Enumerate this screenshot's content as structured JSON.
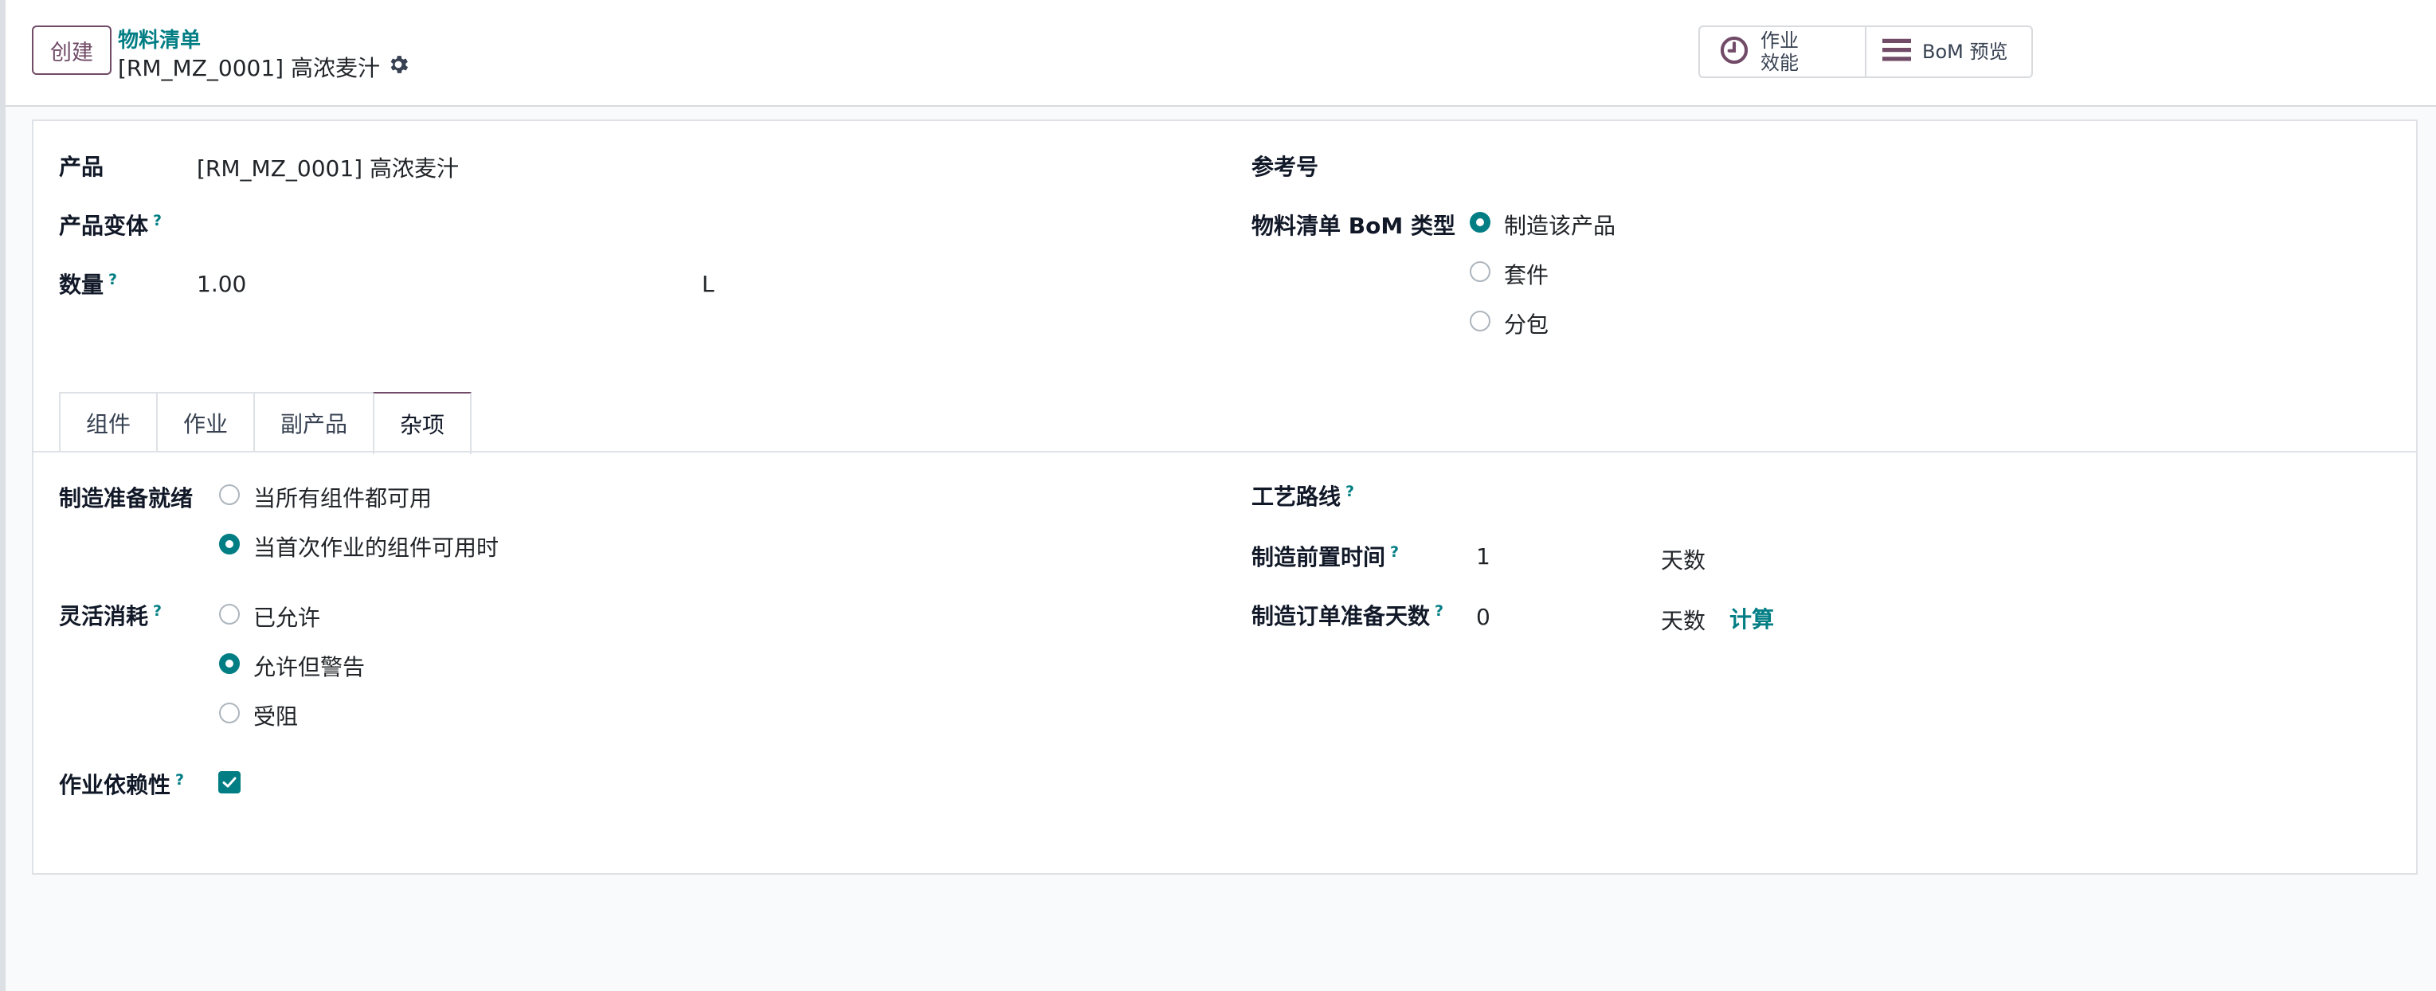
{
  "control_panel": {
    "create_label": "创建",
    "breadcrumb_parent": "物料清单",
    "breadcrumb_current": "[RM_MZ_0001] 高浓麦汁",
    "smart_buttons": {
      "work_efficiency_line1": "作业",
      "work_efficiency_line2": "效能",
      "bom_preview": "BoM 预览"
    }
  },
  "form": {
    "product_label": "产品",
    "product_value": "[RM_MZ_0001] 高浓麦汁",
    "variant_label": "产品变体",
    "quantity_label": "数量",
    "quantity_value": "1.00",
    "quantity_uom": "L",
    "reference_label": "参考号",
    "bom_type_label": "物料清单 BoM 类型",
    "bom_type_options": [
      "制造该产品",
      "套件",
      "分包"
    ],
    "bom_type_selected": "制造该产品",
    "help_marker": "?"
  },
  "tabs": [
    "组件",
    "作业",
    "副产品",
    "杂项"
  ],
  "active_tab": "杂项",
  "misc": {
    "ready_label": "制造准备就绪",
    "ready_options": [
      "当所有组件都可用",
      "当首次作业的组件可用时"
    ],
    "ready_selected": "当首次作业的组件可用时",
    "flex_label": "灵活消耗",
    "flex_options": [
      "已允许",
      "允许但警告",
      "受阻"
    ],
    "flex_selected": "允许但警告",
    "dependency_label": "作业依赖性",
    "dependency_checked": true,
    "routing_label": "工艺路线",
    "lead_time_label": "制造前置时间",
    "lead_time_value": "1",
    "lead_time_unit": "天数",
    "prep_days_label": "制造订单准备天数",
    "prep_days_value": "0",
    "prep_days_unit": "天数",
    "compute_link": "计算"
  },
  "colors": {
    "brand": "#714b67",
    "accent": "#017e84"
  },
  "icons": [
    "gear-icon",
    "clock-icon",
    "list-icon",
    "check-icon"
  ]
}
